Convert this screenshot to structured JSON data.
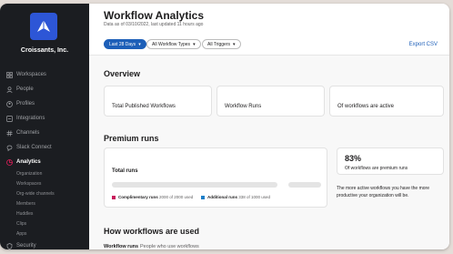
{
  "workspace": {
    "name": "Croissants, Inc."
  },
  "sidebar": {
    "items": [
      {
        "label": "Workspaces",
        "icon": "grid-icon"
      },
      {
        "label": "People",
        "icon": "people-icon"
      },
      {
        "label": "Profiles",
        "icon": "profile-icon"
      },
      {
        "label": "Integrations",
        "icon": "integrations-icon"
      },
      {
        "label": "Channels",
        "icon": "hash-icon"
      },
      {
        "label": "Slack Connect",
        "icon": "slack-connect-icon"
      },
      {
        "label": "Analytics",
        "icon": "analytics-icon"
      }
    ],
    "sub_items": [
      "Organization",
      "Workspaces",
      "Org-wide channels",
      "Members",
      "Huddles",
      "Clips",
      "Apps"
    ],
    "bottom_item": {
      "label": "Security",
      "icon": "shield-icon"
    }
  },
  "header": {
    "title": "Workflow Analytics",
    "subtitle": "Data as of 03/10/2022, last updated 11 hours ago",
    "filters": [
      "Last 28 Days",
      "All Workflow Types",
      "All Triggers"
    ],
    "export_label": "Export CSV"
  },
  "overview": {
    "title": "Overview",
    "cards": [
      "Total Published Workflows",
      "Workflow Runs",
      "Of workflows are active"
    ]
  },
  "premium_runs": {
    "title": "Premium runs",
    "total_label": "Total runs",
    "legend": [
      {
        "name": "Complimentary runs",
        "detail": "2000 of 2000 used",
        "color": "#c8195c"
      },
      {
        "name": "Additional runs",
        "detail": "338 of 1000 used",
        "color": "#1d7fc8"
      }
    ],
    "stat_value": "83%",
    "stat_label": "Of workflows are premium runs",
    "note": "The more active workflows you have the more productive your organization will be."
  },
  "usage": {
    "title": "How workflows are used",
    "tabs": [
      "Workflow runs",
      "People who use workflows"
    ]
  },
  "colors": {
    "accent": "#1d5fb8",
    "sidebar_bg": "#1b1d21",
    "logo_bg": "#2d56d6"
  }
}
